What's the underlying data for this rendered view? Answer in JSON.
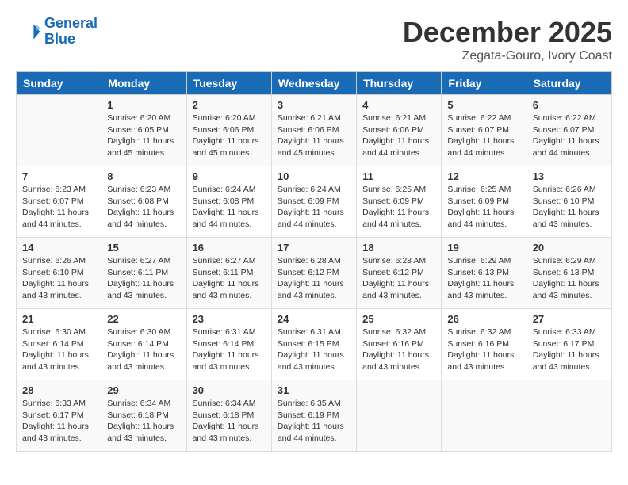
{
  "header": {
    "logo_line1": "General",
    "logo_line2": "Blue",
    "title": "December 2025",
    "subtitle": "Zegata-Gouro, Ivory Coast"
  },
  "columns": [
    "Sunday",
    "Monday",
    "Tuesday",
    "Wednesday",
    "Thursday",
    "Friday",
    "Saturday"
  ],
  "weeks": [
    [
      {
        "day": "",
        "sunrise": "",
        "sunset": "",
        "daylight": ""
      },
      {
        "day": "1",
        "sunrise": "Sunrise: 6:20 AM",
        "sunset": "Sunset: 6:05 PM",
        "daylight": "Daylight: 11 hours and 45 minutes."
      },
      {
        "day": "2",
        "sunrise": "Sunrise: 6:20 AM",
        "sunset": "Sunset: 6:06 PM",
        "daylight": "Daylight: 11 hours and 45 minutes."
      },
      {
        "day": "3",
        "sunrise": "Sunrise: 6:21 AM",
        "sunset": "Sunset: 6:06 PM",
        "daylight": "Daylight: 11 hours and 45 minutes."
      },
      {
        "day": "4",
        "sunrise": "Sunrise: 6:21 AM",
        "sunset": "Sunset: 6:06 PM",
        "daylight": "Daylight: 11 hours and 44 minutes."
      },
      {
        "day": "5",
        "sunrise": "Sunrise: 6:22 AM",
        "sunset": "Sunset: 6:07 PM",
        "daylight": "Daylight: 11 hours and 44 minutes."
      },
      {
        "day": "6",
        "sunrise": "Sunrise: 6:22 AM",
        "sunset": "Sunset: 6:07 PM",
        "daylight": "Daylight: 11 hours and 44 minutes."
      }
    ],
    [
      {
        "day": "7",
        "sunrise": "Sunrise: 6:23 AM",
        "sunset": "Sunset: 6:07 PM",
        "daylight": "Daylight: 11 hours and 44 minutes."
      },
      {
        "day": "8",
        "sunrise": "Sunrise: 6:23 AM",
        "sunset": "Sunset: 6:08 PM",
        "daylight": "Daylight: 11 hours and 44 minutes."
      },
      {
        "day": "9",
        "sunrise": "Sunrise: 6:24 AM",
        "sunset": "Sunset: 6:08 PM",
        "daylight": "Daylight: 11 hours and 44 minutes."
      },
      {
        "day": "10",
        "sunrise": "Sunrise: 6:24 AM",
        "sunset": "Sunset: 6:09 PM",
        "daylight": "Daylight: 11 hours and 44 minutes."
      },
      {
        "day": "11",
        "sunrise": "Sunrise: 6:25 AM",
        "sunset": "Sunset: 6:09 PM",
        "daylight": "Daylight: 11 hours and 44 minutes."
      },
      {
        "day": "12",
        "sunrise": "Sunrise: 6:25 AM",
        "sunset": "Sunset: 6:09 PM",
        "daylight": "Daylight: 11 hours and 44 minutes."
      },
      {
        "day": "13",
        "sunrise": "Sunrise: 6:26 AM",
        "sunset": "Sunset: 6:10 PM",
        "daylight": "Daylight: 11 hours and 43 minutes."
      }
    ],
    [
      {
        "day": "14",
        "sunrise": "Sunrise: 6:26 AM",
        "sunset": "Sunset: 6:10 PM",
        "daylight": "Daylight: 11 hours and 43 minutes."
      },
      {
        "day": "15",
        "sunrise": "Sunrise: 6:27 AM",
        "sunset": "Sunset: 6:11 PM",
        "daylight": "Daylight: 11 hours and 43 minutes."
      },
      {
        "day": "16",
        "sunrise": "Sunrise: 6:27 AM",
        "sunset": "Sunset: 6:11 PM",
        "daylight": "Daylight: 11 hours and 43 minutes."
      },
      {
        "day": "17",
        "sunrise": "Sunrise: 6:28 AM",
        "sunset": "Sunset: 6:12 PM",
        "daylight": "Daylight: 11 hours and 43 minutes."
      },
      {
        "day": "18",
        "sunrise": "Sunrise: 6:28 AM",
        "sunset": "Sunset: 6:12 PM",
        "daylight": "Daylight: 11 hours and 43 minutes."
      },
      {
        "day": "19",
        "sunrise": "Sunrise: 6:29 AM",
        "sunset": "Sunset: 6:13 PM",
        "daylight": "Daylight: 11 hours and 43 minutes."
      },
      {
        "day": "20",
        "sunrise": "Sunrise: 6:29 AM",
        "sunset": "Sunset: 6:13 PM",
        "daylight": "Daylight: 11 hours and 43 minutes."
      }
    ],
    [
      {
        "day": "21",
        "sunrise": "Sunrise: 6:30 AM",
        "sunset": "Sunset: 6:14 PM",
        "daylight": "Daylight: 11 hours and 43 minutes."
      },
      {
        "day": "22",
        "sunrise": "Sunrise: 6:30 AM",
        "sunset": "Sunset: 6:14 PM",
        "daylight": "Daylight: 11 hours and 43 minutes."
      },
      {
        "day": "23",
        "sunrise": "Sunrise: 6:31 AM",
        "sunset": "Sunset: 6:14 PM",
        "daylight": "Daylight: 11 hours and 43 minutes."
      },
      {
        "day": "24",
        "sunrise": "Sunrise: 6:31 AM",
        "sunset": "Sunset: 6:15 PM",
        "daylight": "Daylight: 11 hours and 43 minutes."
      },
      {
        "day": "25",
        "sunrise": "Sunrise: 6:32 AM",
        "sunset": "Sunset: 6:16 PM",
        "daylight": "Daylight: 11 hours and 43 minutes."
      },
      {
        "day": "26",
        "sunrise": "Sunrise: 6:32 AM",
        "sunset": "Sunset: 6:16 PM",
        "daylight": "Daylight: 11 hours and 43 minutes."
      },
      {
        "day": "27",
        "sunrise": "Sunrise: 6:33 AM",
        "sunset": "Sunset: 6:17 PM",
        "daylight": "Daylight: 11 hours and 43 minutes."
      }
    ],
    [
      {
        "day": "28",
        "sunrise": "Sunrise: 6:33 AM",
        "sunset": "Sunset: 6:17 PM",
        "daylight": "Daylight: 11 hours and 43 minutes."
      },
      {
        "day": "29",
        "sunrise": "Sunrise: 6:34 AM",
        "sunset": "Sunset: 6:18 PM",
        "daylight": "Daylight: 11 hours and 43 minutes."
      },
      {
        "day": "30",
        "sunrise": "Sunrise: 6:34 AM",
        "sunset": "Sunset: 6:18 PM",
        "daylight": "Daylight: 11 hours and 43 minutes."
      },
      {
        "day": "31",
        "sunrise": "Sunrise: 6:35 AM",
        "sunset": "Sunset: 6:19 PM",
        "daylight": "Daylight: 11 hours and 44 minutes."
      },
      {
        "day": "",
        "sunrise": "",
        "sunset": "",
        "daylight": ""
      },
      {
        "day": "",
        "sunrise": "",
        "sunset": "",
        "daylight": ""
      },
      {
        "day": "",
        "sunrise": "",
        "sunset": "",
        "daylight": ""
      }
    ]
  ]
}
